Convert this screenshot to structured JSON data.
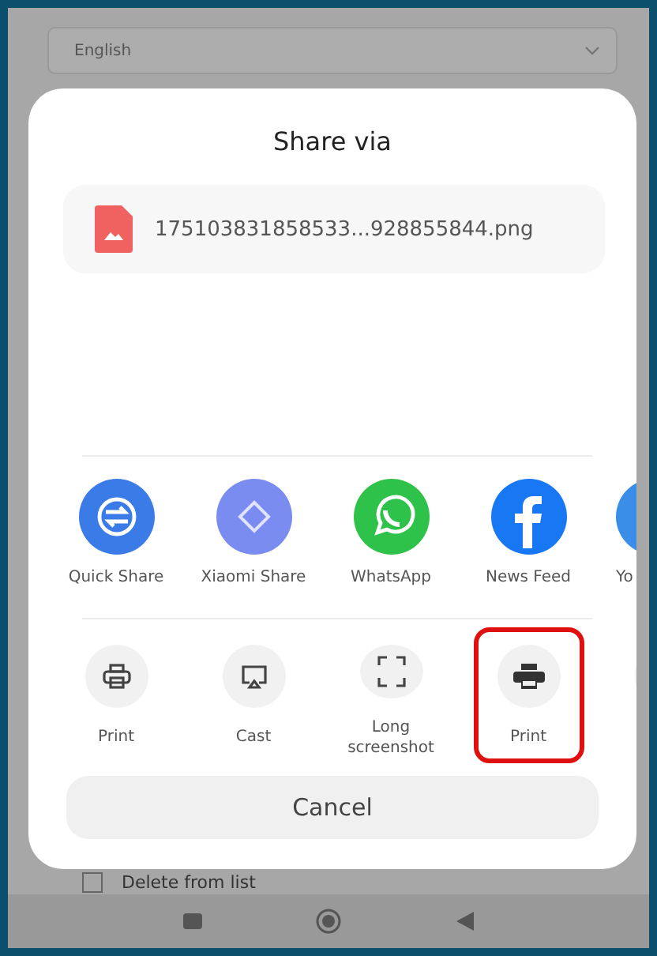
{
  "background": {
    "language_select": {
      "value": "English"
    },
    "checkbox": {
      "label": "Delete from list",
      "checked": false
    }
  },
  "sheet": {
    "title": "Share via",
    "file": {
      "name": "175103831858533...928855844.png"
    },
    "apps": [
      {
        "label": "Quick Share",
        "kind": "quickshare",
        "color": "#3b7be8"
      },
      {
        "label": "Xiaomi Share",
        "kind": "xiaomi",
        "color": "#7b8cf0"
      },
      {
        "label": "WhatsApp",
        "kind": "whatsapp",
        "color": "#2fc24a"
      },
      {
        "label": "News Feed",
        "kind": "facebook",
        "color": "#1877f2"
      },
      {
        "label": "Yo",
        "kind": "partial",
        "color": "#3b8ee8"
      }
    ],
    "actions": [
      {
        "label": "Print",
        "kind": "print-outline",
        "highlighted": false
      },
      {
        "label": "Cast",
        "kind": "cast",
        "highlighted": false
      },
      {
        "label": "Long screenshot",
        "kind": "screenshot",
        "highlighted": false
      },
      {
        "label": "Print",
        "kind": "print-filled",
        "highlighted": true
      },
      {
        "kind": "partial",
        "highlighted": false
      }
    ],
    "cancel": "Cancel"
  }
}
